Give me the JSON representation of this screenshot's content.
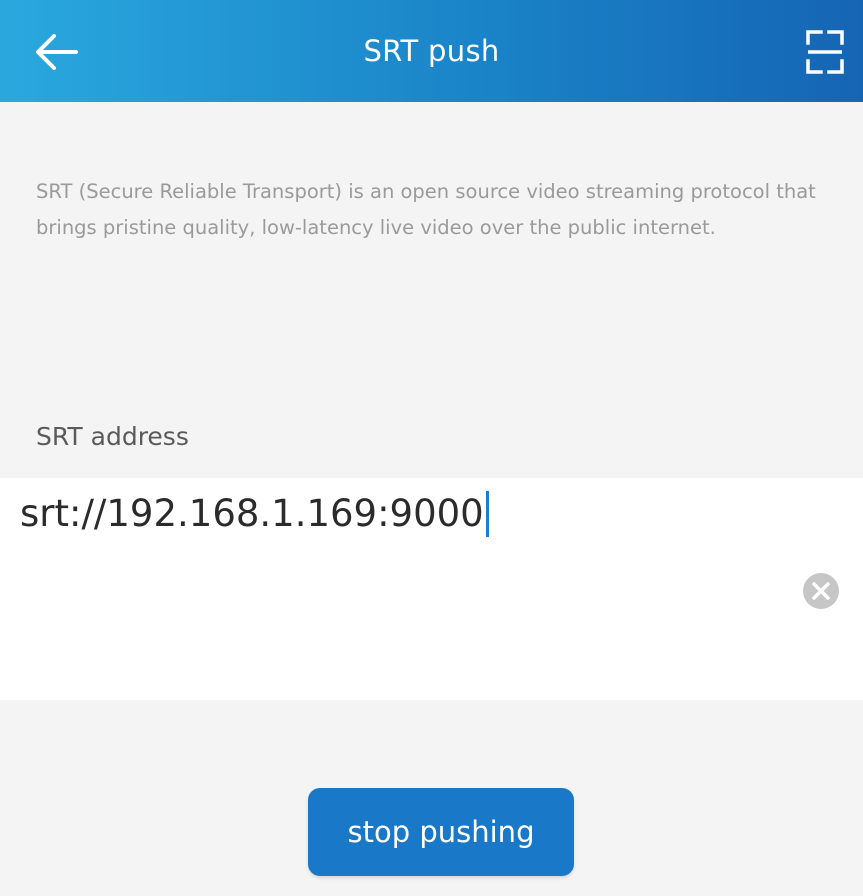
{
  "header": {
    "title": "SRT push",
    "back_icon": "arrow-left-icon",
    "scan_icon": "scan-icon"
  },
  "description": "SRT (Secure Reliable Transport) is an open source video streaming protocol that brings pristine quality, low-latency live video over the public internet.",
  "address": {
    "label": "SRT address",
    "value": "srt://192.168.1.169:9000",
    "clear_icon": "clear-icon"
  },
  "actions": {
    "stop_label": "stop pushing"
  },
  "colors": {
    "header_gradient_start": "#2aa8de",
    "header_gradient_end": "#1565b4",
    "button": "#1a78c8",
    "caret": "#1a7fd0"
  }
}
